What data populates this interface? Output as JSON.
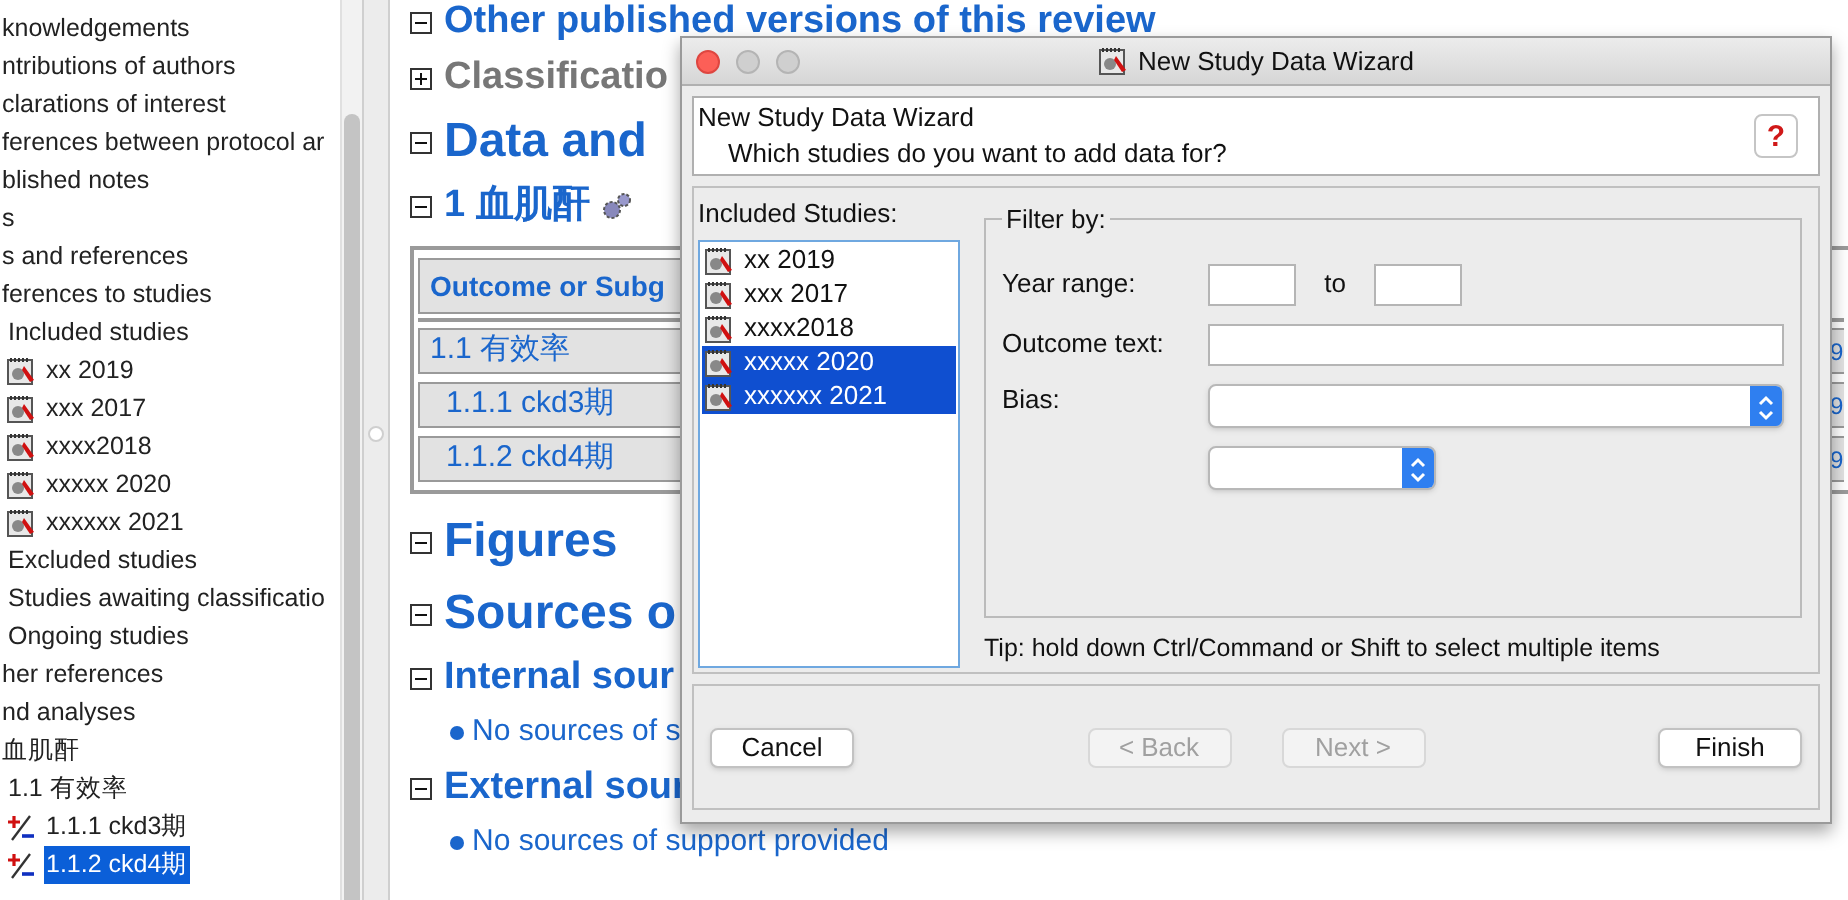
{
  "tree": [
    {
      "label": "knowledgements",
      "selected": false
    },
    {
      "label": "ntributions of authors",
      "selected": false
    },
    {
      "label": "clarations of interest",
      "selected": false
    },
    {
      "label": "ferences between protocol ar",
      "selected": false
    },
    {
      "label": "blished notes",
      "selected": false
    },
    {
      "label": "s",
      "selected": false
    },
    {
      "label": "s and references",
      "selected": false
    },
    {
      "label": "ferences to studies",
      "selected": false,
      "children": [
        {
          "label": "Included studies",
          "selected": false,
          "children": [
            {
              "label": "xx 2019",
              "kind": "study",
              "selected": false
            },
            {
              "label": "xxx 2017",
              "kind": "study",
              "selected": false
            },
            {
              "label": "xxxx2018",
              "kind": "study",
              "selected": false
            },
            {
              "label": "xxxxx 2020",
              "kind": "study",
              "selected": false
            },
            {
              "label": "xxxxxx 2021",
              "kind": "study",
              "selected": false
            }
          ]
        },
        {
          "label": "Excluded studies",
          "selected": false
        },
        {
          "label": "Studies awaiting classificatio",
          "selected": false
        },
        {
          "label": "Ongoing studies",
          "selected": false
        }
      ]
    },
    {
      "label": "her references",
      "selected": false
    },
    {
      "label": "nd analyses",
      "selected": false
    },
    {
      "label": "血肌酐",
      "selected": false,
      "children": [
        {
          "label": "1.1 有效率",
          "selected": false,
          "children": [
            {
              "label": "1.1.1 ckd3期",
              "kind": "comparison",
              "selected": false
            },
            {
              "label": "1.1.2 ckd4期",
              "kind": "comparison",
              "selected": true
            }
          ]
        }
      ]
    }
  ],
  "sections": [
    {
      "kind": "heading2",
      "text": "Other published versions of this review",
      "expanded": true,
      "greyed": false
    },
    {
      "kind": "heading2",
      "text": "Classificatio",
      "expanded": false,
      "greyed": true
    },
    {
      "kind": "heading1",
      "text": "Data and",
      "expanded": true,
      "greyed": false
    },
    {
      "kind": "heading2",
      "text": "1 血肌酐",
      "expanded": true,
      "greyed": false,
      "gear": true
    },
    {
      "kind": "table",
      "header": "Outcome or Subg",
      "rows": [
        {
          "label": "1.1 有效率",
          "column_last": "9",
          "children": [
            {
              "label": "1.1.1 ckd3期",
              "column_last": "9"
            },
            {
              "label": "1.1.2 ckd4期",
              "column_last": "9"
            }
          ]
        }
      ]
    },
    {
      "kind": "heading1",
      "text": "Figures",
      "expanded": true,
      "greyed": false
    },
    {
      "kind": "heading1",
      "text": "Sources o",
      "expanded": true,
      "greyed": false
    },
    {
      "kind": "heading2",
      "text": "Internal sour",
      "expanded": true,
      "greyed": false
    },
    {
      "kind": "bullet",
      "text": "No sources of s"
    },
    {
      "kind": "heading2",
      "text": "External sour",
      "expanded": true,
      "greyed": false
    },
    {
      "kind": "bullet",
      "text": "No sources of support provided"
    }
  ],
  "dialog": {
    "title": "New Study Data Wizard",
    "header_title": "New Study Data Wizard",
    "header_subtitle": "Which studies do you want to add data for?",
    "help": "?",
    "studies_label": "Included Studies:",
    "studies": [
      {
        "label": "xx 2019",
        "selected": false
      },
      {
        "label": "xxx 2017",
        "selected": false
      },
      {
        "label": "xxxx2018",
        "selected": false
      },
      {
        "label": "xxxxx 2020",
        "selected": true
      },
      {
        "label": "xxxxxx 2021",
        "selected": true
      }
    ],
    "filter": {
      "legend": "Filter by:",
      "year_label": "Year range:",
      "to": "to",
      "outcome_label": "Outcome text:",
      "bias_label": "Bias:"
    },
    "tip": "Tip: hold down Ctrl/Command or Shift to select multiple items",
    "buttons": [
      {
        "label": "Cancel",
        "disabled": false
      },
      {
        "label": "< Back",
        "disabled": true
      },
      {
        "label": "Next >",
        "disabled": true
      },
      {
        "label": "Finish",
        "disabled": false
      }
    ]
  }
}
